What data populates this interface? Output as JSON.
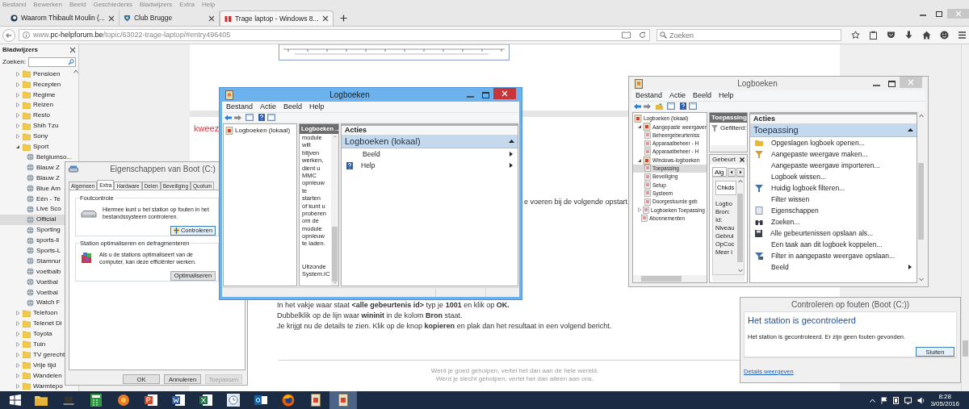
{
  "browser": {
    "menu": [
      "Bestand",
      "Bewerken",
      "Beeld",
      "Geschiedenis",
      "Bladwijzers",
      "Extra",
      "Help"
    ],
    "tabs": [
      {
        "label": "Waarom Thibault Moulin (...",
        "selected": false
      },
      {
        "label": "Club Brugge",
        "selected": false
      },
      {
        "label": "Trage laptop - Windows 8...",
        "selected": true
      }
    ],
    "address": {
      "prefix": "www.",
      "host": "pc-helpforum.be",
      "path": "/topic/63022-trage-laptop/#entry496405"
    },
    "search": {
      "placeholder": "Zoeken"
    }
  },
  "bookmarks": {
    "title": "Bladwijzers",
    "search_label": "Zoeken:",
    "items": [
      {
        "label": "Pensioen",
        "expanded": false
      },
      {
        "label": "Recepten",
        "expanded": false
      },
      {
        "label": "Regime",
        "expanded": false
      },
      {
        "label": "Reizen",
        "expanded": false
      },
      {
        "label": "Resto",
        "expanded": false
      },
      {
        "label": "Shih Tzu",
        "expanded": false
      },
      {
        "label": "Sony",
        "expanded": false
      },
      {
        "label": "Sport",
        "expanded": true,
        "children": [
          {
            "label": "Belgiumso...",
            "selected": false
          },
          {
            "label": "Blauw Z",
            "selected": false
          },
          {
            "label": "Blauw Z",
            "selected": false
          },
          {
            "label": "Blue Am",
            "selected": false
          },
          {
            "label": "Eén - Te",
            "selected": false
          },
          {
            "label": "Live Sco",
            "selected": false
          },
          {
            "label": "Official",
            "selected": true
          },
          {
            "label": "Sporting",
            "selected": false
          },
          {
            "label": "sports-li",
            "selected": false
          },
          {
            "label": "Sports-L",
            "selected": false
          },
          {
            "label": "Stamnur",
            "selected": false
          },
          {
            "label": "voetbalb",
            "selected": false
          },
          {
            "label": "Voetbal",
            "selected": false
          },
          {
            "label": "Voetbal",
            "selected": false
          },
          {
            "label": "Watch F",
            "selected": false
          }
        ]
      },
      {
        "label": "Telefoon",
        "expanded": false
      },
      {
        "label": "Telenet Di",
        "expanded": false
      },
      {
        "label": "Toyota",
        "expanded": false
      },
      {
        "label": "Tuin",
        "expanded": false
      },
      {
        "label": "TV gerecht",
        "expanded": false
      },
      {
        "label": "Vrije tijd",
        "expanded": false
      },
      {
        "label": "Wandelen",
        "expanded": false
      },
      {
        "label": "Warmtepo",
        "expanded": false
      }
    ]
  },
  "page": {
    "heading_fragment": "kweez",
    "text_fragment": "e voeren bij de volgende opstart.",
    "instructions": [
      "In het vakje waar staat **<alle gebeurtenis id>** typ je **1001** en klik op **OK.**",
      "Dubbelklik op de lijn waar **wininit** in de kolom **Bron** staat.",
      "Je krijgt nu de details te zien. Klik op de knop **kopieren** en plak dan het resultaat in een volgend bericht."
    ],
    "footer": [
      "Werd je goed geholpen, vertel het dan aan de hele wereld.",
      "Werd je slecht geholpen, vertel het dan alleen aan ons."
    ]
  },
  "properties_window": {
    "title": "Eigenschappen van Boot (C:)",
    "active": false,
    "tabs": [
      {
        "label": "Algemeen",
        "selected": false
      },
      {
        "label": "Extra",
        "selected": true
      },
      {
        "label": "Hardware",
        "selected": false
      },
      {
        "label": "Delen",
        "selected": false
      },
      {
        "label": "Beveiliging",
        "selected": false
      },
      {
        "label": "Quotum",
        "selected": false
      }
    ],
    "groups": [
      {
        "title": "Foutcontrole",
        "text": "Hiermee kunt u het station op fouten in het bestandssysteem controleren.",
        "button": "Controleren"
      },
      {
        "title": "Station optimaliseren en defragmenteren",
        "text": "Als u de stations optimaliseert van de computer, kan deze efficiënter werken.",
        "button": "Optimaliseren"
      }
    ],
    "buttons": [
      {
        "label": "OK",
        "disabled": false
      },
      {
        "label": "Annuleren",
        "disabled": false
      },
      {
        "label": "Toepassen",
        "disabled": true
      }
    ]
  },
  "log_window_front": {
    "title": "Logboeken",
    "active": true,
    "menu": [
      "Bestand",
      "Actie",
      "Beeld",
      "Help"
    ],
    "tree": [
      {
        "label": "Logboeken (lokaal)"
      }
    ],
    "middle": {
      "header": "Logboeken ...",
      "lines": [
        "module",
        "wilt",
        "blijven",
        "werken,",
        "dient u",
        "MMC",
        "opnieuw",
        "te",
        "starten",
        "of kunt u",
        "proberen",
        "om de",
        "module",
        "opnieuw",
        "te laden."
      ],
      "lines_after_gap": [
        "Uitzonde",
        "System.IC"
      ]
    },
    "actions": {
      "header": "Acties",
      "section": "Logboeken (lokaal)",
      "items": [
        {
          "label": "Beeld",
          "submenu": true
        },
        {
          "label": "Help",
          "submenu": true
        }
      ]
    }
  },
  "log_window_back": {
    "title": "Logboeken",
    "active": false,
    "menu": [
      "Bestand",
      "Actie",
      "Beeld",
      "Help"
    ],
    "tree": [
      {
        "label": "Logboeken (lokaal)",
        "selected": false,
        "children": [
          {
            "label": "Aangepaste weergaver",
            "expanded": true,
            "selected": false,
            "children": [
              {
                "label": "Beheergebeurteniss",
                "selected": false
              },
              {
                "label": "Apparaatbeheer - H",
                "selected": false
              },
              {
                "label": "Apparaatbeheer - H",
                "selected": false
              }
            ]
          },
          {
            "label": "Windows-logboeken",
            "expanded": true,
            "selected": false,
            "children": [
              {
                "label": "Toepassing",
                "selected": true
              },
              {
                "label": "Beveiliging",
                "selected": false
              },
              {
                "label": "Setup",
                "selected": false
              },
              {
                "label": "Systeem",
                "selected": false
              },
              {
                "label": "Doorgestuurde geb",
                "selected": false
              }
            ]
          },
          {
            "label": "Logboeken Toepassing",
            "expanded": false,
            "selected": false
          },
          {
            "label": "Abonnementen",
            "selected": false
          }
        ]
      }
    ],
    "middle": {
      "header": "Toepassing",
      "filter": "Gefilterd:",
      "event_header": "Gebeurt",
      "event_tab": "Alg",
      "event_text": "Chkds",
      "fields": [
        "Logbo",
        "Bron:",
        "Id:",
        "Niveau",
        "Gebrui",
        "OpCoc",
        "Meer i"
      ]
    },
    "actions": {
      "header": "Acties",
      "section": "Toepassing",
      "items": [
        {
          "label": "Opgeslagen logboek openen...",
          "submenu": false
        },
        {
          "label": "Aangepaste weergave maken...",
          "submenu": false
        },
        {
          "label": "Aangepaste weergave importeren...",
          "submenu": false
        },
        {
          "label": "Logboek wissen...",
          "submenu": false
        },
        {
          "label": "Huidig logboek filteren...",
          "submenu": false
        },
        {
          "label": "Filter wissen",
          "submenu": false
        },
        {
          "label": "Eigenschappen",
          "submenu": false
        },
        {
          "label": "Zoeken...",
          "submenu": false
        },
        {
          "label": "Alle gebeurtenissen opslaan als...",
          "submenu": false
        },
        {
          "label": "Een taak aan dit logboek koppelen...",
          "submenu": false
        },
        {
          "label": "Filter in aangepaste weergave opslaan...",
          "submenu": false
        },
        {
          "label": "Beeld",
          "submenu": true
        }
      ]
    }
  },
  "check_dialog": {
    "title": "Controleren op fouten (Boot (C:))",
    "active": false,
    "heading": "Het station is gecontroleerd",
    "message": "Het station is gecontroleerd. Er zijn geen fouten gevonden.",
    "button": "Sluiten",
    "link": "Details weergeven"
  },
  "taskbar": {
    "items": [
      {
        "selected": false
      },
      {
        "selected": false
      },
      {
        "selected": false
      },
      {
        "selected": false
      },
      {
        "selected": false
      },
      {
        "selected": false
      },
      {
        "selected": false
      },
      {
        "selected": false
      },
      {
        "selected": false
      },
      {
        "selected": false
      },
      {
        "selected": false
      },
      {
        "selected": true
      }
    ],
    "time": "8:28",
    "date": "3/05/2016"
  }
}
